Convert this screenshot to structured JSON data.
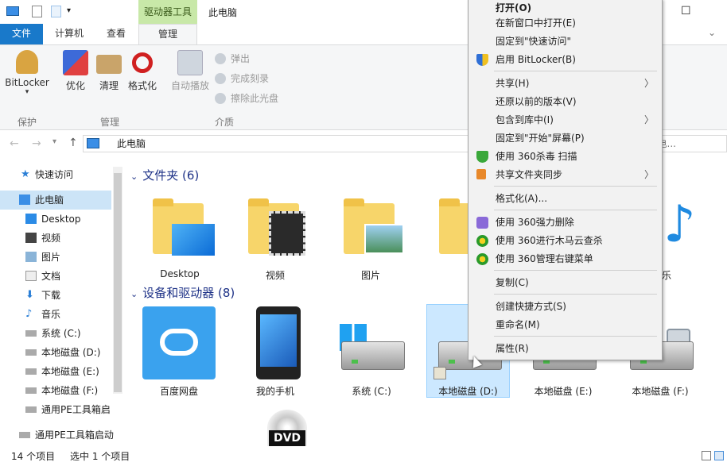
{
  "titlebar": {
    "title": "此电脑",
    "context_tab": "驱动器工具",
    "qat": [
      "pc-icon",
      "checklist-icon",
      "blank-icon",
      "dropdown-icon"
    ],
    "maximize": "☐"
  },
  "tabs": {
    "file": "文件",
    "computer": "计算机",
    "view": "查看",
    "manage": "管理"
  },
  "ribbon": {
    "bitlocker": "BitLocker",
    "optimize": "优化",
    "cleanup": "清理",
    "format": "格式化",
    "autoplay": "自动播放",
    "eject": "弹出",
    "finalize": "完成刻录",
    "erase": "擦除此光盘",
    "groups": {
      "protect": "保护",
      "manage": "管理",
      "media": "介质"
    },
    "help": "?"
  },
  "address": {
    "path": "此电脑",
    "search": "搜索\"此电..."
  },
  "nav": {
    "items": [
      {
        "label": "快速访问"
      },
      {
        "label": "此电脑"
      },
      {
        "label": "Desktop"
      },
      {
        "label": "视频"
      },
      {
        "label": "图片"
      },
      {
        "label": "文档"
      },
      {
        "label": "下载"
      },
      {
        "label": "音乐"
      },
      {
        "label": "系统 (C:)"
      },
      {
        "label": "本地磁盘 (D:)"
      },
      {
        "label": "本地磁盘 (E:)"
      },
      {
        "label": "本地磁盘 (F:)"
      },
      {
        "label": "通用PE工具箱启"
      },
      {
        "label": "通用PE工具箱启动"
      }
    ]
  },
  "content": {
    "folders_header": "文件夹 (6)",
    "devices_header": "设备和驱动器 (8)",
    "folders": [
      {
        "label": "Desktop"
      },
      {
        "label": "视频"
      },
      {
        "label": "图片"
      },
      {
        "label": "文"
      },
      {
        "label": "乐"
      }
    ],
    "devices": [
      {
        "label": "百度网盘"
      },
      {
        "label": "我的手机"
      },
      {
        "label": "系统 (C:)"
      },
      {
        "label": "本地磁盘 (D:)"
      },
      {
        "label": "本地磁盘 (E:)"
      },
      {
        "label": "本地磁盘 (F:)"
      }
    ],
    "dvd": "DVD"
  },
  "status": {
    "count": "14 个项目",
    "selected": "选中 1 个项目"
  },
  "context_menu": {
    "items": [
      {
        "label": "打开(O)",
        "bold": true
      },
      {
        "label": "在新窗口中打开(E)"
      },
      {
        "label": "固定到\"快速访问\""
      },
      {
        "label": "启用 BitLocker(B)",
        "icon": "shield-icon"
      },
      {
        "label": "共享(H)",
        "submenu": true
      },
      {
        "label": "还原以前的版本(V)"
      },
      {
        "label": "包含到库中(I)",
        "submenu": true
      },
      {
        "label": "固定到\"开始\"屏幕(P)"
      },
      {
        "label": "使用 360杀毒 扫描",
        "icon": "360-antivirus-icon"
      },
      {
        "label": "共享文件夹同步",
        "icon": "sync-icon",
        "submenu": true
      },
      {
        "label": "格式化(A)..."
      },
      {
        "label": "使用 360强力删除",
        "icon": "360-delete-icon"
      },
      {
        "label": "使用 360进行木马云查杀",
        "icon": "360-trojan-icon"
      },
      {
        "label": "使用 360管理右键菜单",
        "icon": "360-menu-icon"
      },
      {
        "label": "复制(C)"
      },
      {
        "label": "创建快捷方式(S)"
      },
      {
        "label": "重命名(M)"
      },
      {
        "label": "属性(R)"
      }
    ]
  },
  "colors": {
    "accent": "#1979ca",
    "selection": "#cce4f7",
    "header": "#1e3287",
    "context_tab": "#c8e8a8"
  }
}
